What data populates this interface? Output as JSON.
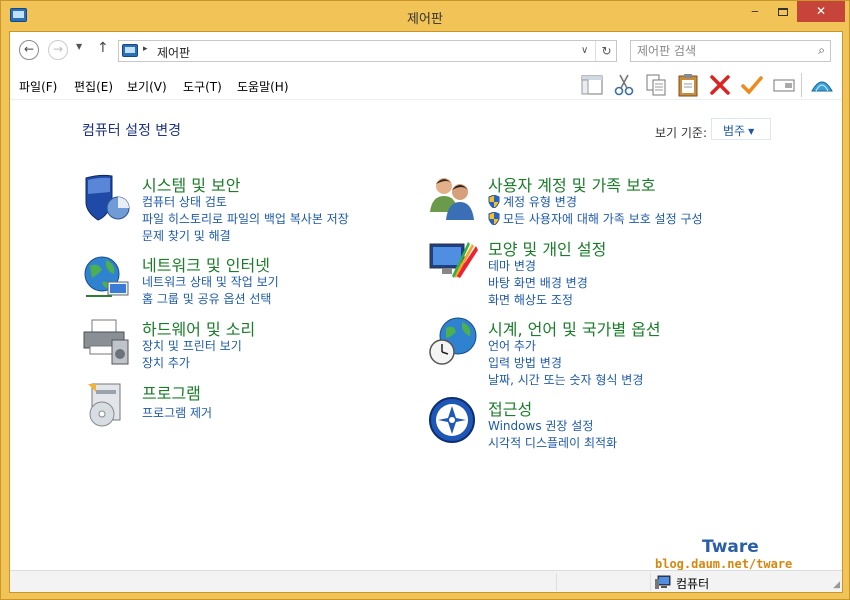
{
  "window": {
    "title": "제어판",
    "controls": {
      "minimize": "‒",
      "close": "✕"
    }
  },
  "address": {
    "path_separator": "▸",
    "path_text": "제어판",
    "refresh": "↻",
    "search_placeholder": "제어판 검색"
  },
  "menu": [
    {
      "label": "파일(F)"
    },
    {
      "label": "편집(E)"
    },
    {
      "label": "보기(V)"
    },
    {
      "label": "도구(T)"
    },
    {
      "label": "도움말(H)"
    }
  ],
  "toolbar_icons": [
    "layout-icon",
    "cut-icon",
    "copy-icon",
    "paste-icon",
    "delete-icon",
    "check-icon",
    "rename-icon",
    "shell-icon"
  ],
  "main": {
    "page_title": "컴퓨터 설정 변경",
    "view_by_label": "보기 기준:",
    "view_by_value": "범주",
    "categories": [
      {
        "title": "시스템 및 보안",
        "icon": "shield-icon",
        "links": [
          "컴퓨터 상태 검토",
          "파일 히스토리로 파일의 백업 복사본 저장",
          "문제 찾기 및 해결"
        ]
      },
      {
        "title": "네트워크 및 인터넷",
        "icon": "network-icon",
        "links": [
          "네트워크 상태 및 작업 보기",
          "홈 그룹 및 공유 옵션 선택"
        ]
      },
      {
        "title": "하드웨어 및 소리",
        "icon": "printer-icon",
        "links": [
          "장치 및 프린터 보기",
          "장치 추가"
        ]
      },
      {
        "title": "프로그램",
        "icon": "programs-icon",
        "links": [
          "프로그램 제거"
        ]
      },
      {
        "title": "사용자 계정 및 가족 보호",
        "icon": "users-icon",
        "links": [
          "계정 유형 변경",
          "모든 사용자에 대해 가족 보호 설정 구성"
        ]
      },
      {
        "title": "모양 및 개인 설정",
        "icon": "appearance-icon",
        "links": [
          "테마 변경",
          "바탕 화면 배경 변경",
          "화면 해상도 조정"
        ]
      },
      {
        "title": "시계, 언어 및 국가별 옵션",
        "icon": "clock-globe-icon",
        "links": [
          "언어 추가",
          "입력 방법 변경",
          "날짜, 시간 또는 숫자 형식 변경"
        ]
      },
      {
        "title": "접근성",
        "icon": "accessibility-icon",
        "links": [
          "Windows 권장 설정",
          "시각적 디스플레이 최적화"
        ]
      }
    ]
  },
  "watermark": {
    "name": "Tware",
    "url": "blog.daum.net/tware"
  },
  "status": {
    "computer_label": "컴퓨터"
  },
  "colors": {
    "frame": "#f2c457",
    "title_link": "#1e3287",
    "category_title": "#1b7d2a",
    "link": "#1e5aaa",
    "close_button": "#c7443a"
  }
}
